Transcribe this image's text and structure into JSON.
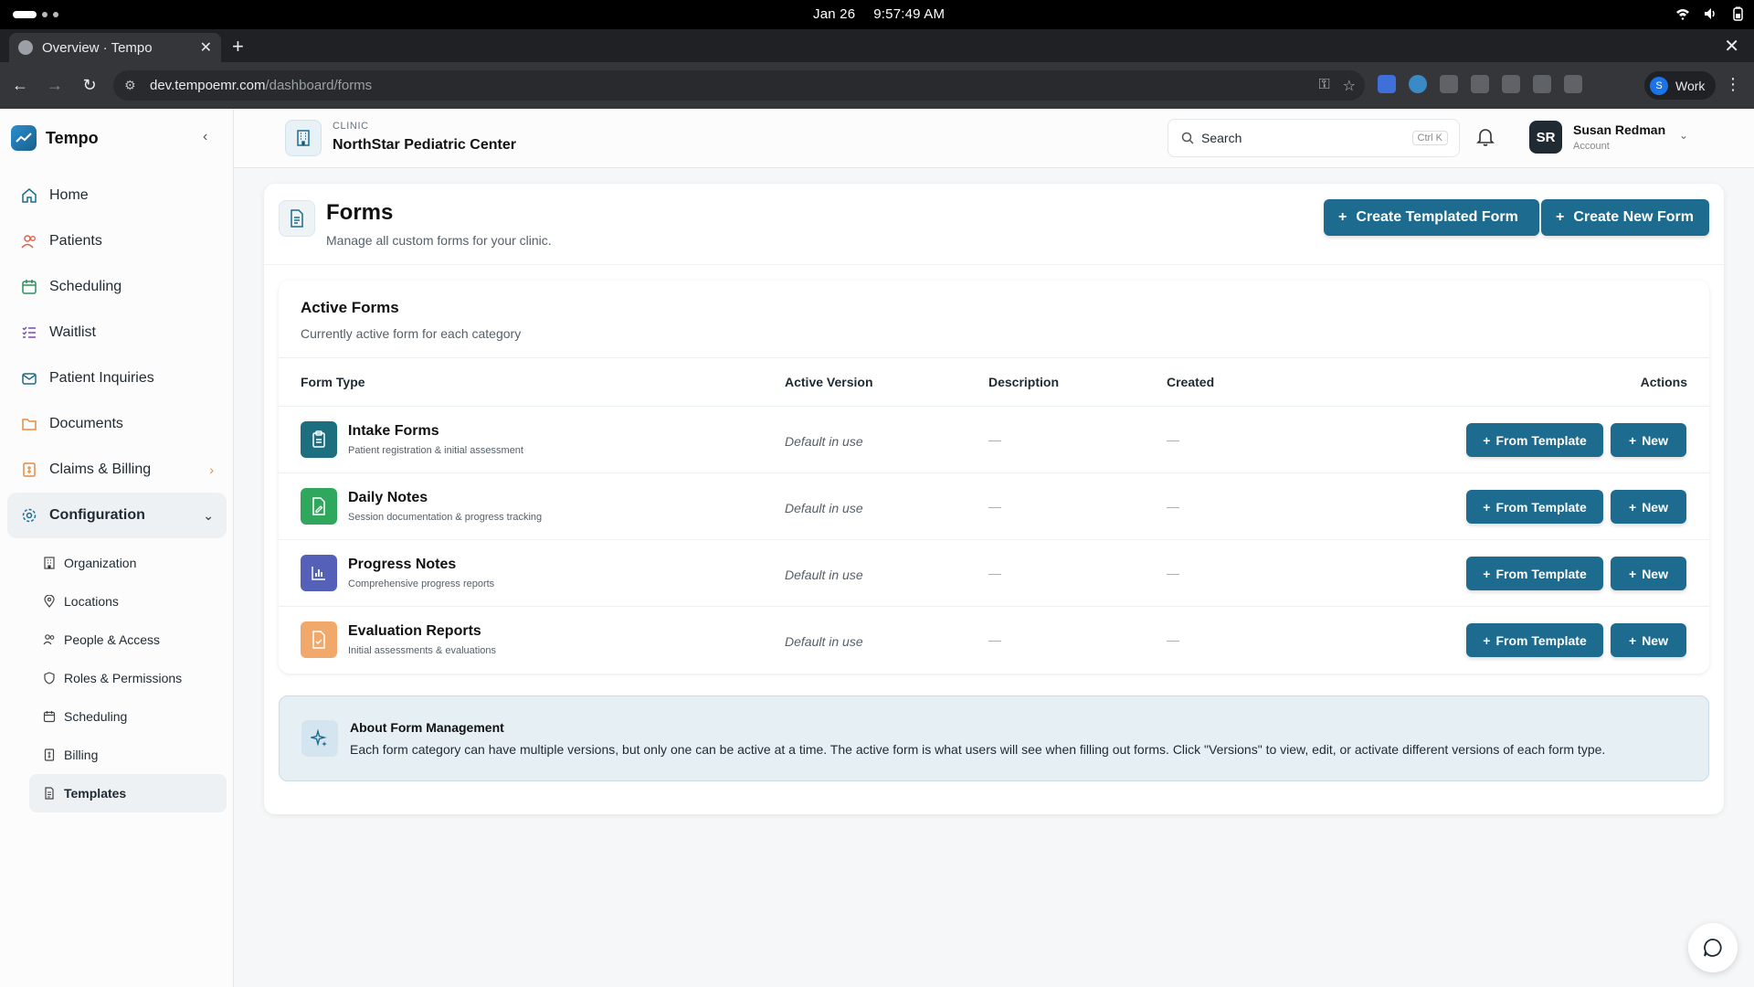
{
  "os": {
    "date": "Jan 26",
    "time": "9:57:49 AM"
  },
  "browser": {
    "tab_title": "Overview · Tempo",
    "url_host": "dev.tempoemr.com",
    "url_path": "/dashboard/forms",
    "profile_initial": "S",
    "profile_label": "Work"
  },
  "sidebar": {
    "brand": "Tempo",
    "items": [
      {
        "label": "Home",
        "icon": "home-icon"
      },
      {
        "label": "Patients",
        "icon": "users-icon"
      },
      {
        "label": "Scheduling",
        "icon": "calendar-icon"
      },
      {
        "label": "Waitlist",
        "icon": "list-check-icon"
      },
      {
        "label": "Patient Inquiries",
        "icon": "mail-icon"
      },
      {
        "label": "Documents",
        "icon": "folder-icon"
      },
      {
        "label": "Claims & Billing",
        "icon": "receipt-icon"
      },
      {
        "label": "Configuration",
        "icon": "gear-icon"
      }
    ],
    "subitems": [
      {
        "label": "Organization",
        "icon": "building-icon"
      },
      {
        "label": "Locations",
        "icon": "map-pin-icon"
      },
      {
        "label": "People & Access",
        "icon": "users-icon"
      },
      {
        "label": "Roles & Permissions",
        "icon": "shield-icon"
      },
      {
        "label": "Scheduling",
        "icon": "calendar-icon"
      },
      {
        "label": "Billing",
        "icon": "receipt-icon"
      },
      {
        "label": "Templates",
        "icon": "document-icon"
      }
    ]
  },
  "header": {
    "clinic_label": "CLINIC",
    "clinic_name": "NorthStar Pediatric Center",
    "search_placeholder": "Search",
    "search_shortcut": "Ctrl K",
    "user_initials": "SR",
    "user_name": "Susan Redman",
    "user_role": "Account"
  },
  "page": {
    "title": "Forms",
    "subtitle": "Manage all custom forms for your clinic.",
    "create_templated_label": "Create Templated Form",
    "create_new_label": "Create New Form"
  },
  "active_forms": {
    "title": "Active Forms",
    "subtitle": "Currently active form for each category",
    "columns": [
      "Form Type",
      "Active Version",
      "Description",
      "Created",
      "Actions"
    ],
    "rows": [
      {
        "name": "Intake Forms",
        "desc": "Patient registration & initial assessment",
        "version": "Default in use",
        "description": "—",
        "created": "—",
        "color": "#1d6f7f",
        "icon": "clipboard-icon"
      },
      {
        "name": "Daily Notes",
        "desc": "Session documentation & progress tracking",
        "version": "Default in use",
        "description": "—",
        "created": "—",
        "color": "#2fa85e",
        "icon": "edit-document-icon"
      },
      {
        "name": "Progress Notes",
        "desc": "Comprehensive progress reports",
        "version": "Default in use",
        "description": "—",
        "created": "—",
        "color": "#5560b8",
        "icon": "bar-chart-icon"
      },
      {
        "name": "Evaluation Reports",
        "desc": "Initial assessments & evaluations",
        "version": "Default in use",
        "description": "—",
        "created": "—",
        "color": "#f0a96a",
        "icon": "check-document-icon"
      }
    ],
    "from_template_label": "From Template",
    "new_label": "New"
  },
  "about": {
    "title": "About Form Management",
    "text": "Each form category can have multiple versions, but only one can be active at a time. The active form is what users will see when filling out forms. Click \"Versions\" to view, edit, or activate different versions of each form type."
  },
  "colors": {
    "primary": "#1d6b8f",
    "accent_orange": "#e88a3c"
  }
}
